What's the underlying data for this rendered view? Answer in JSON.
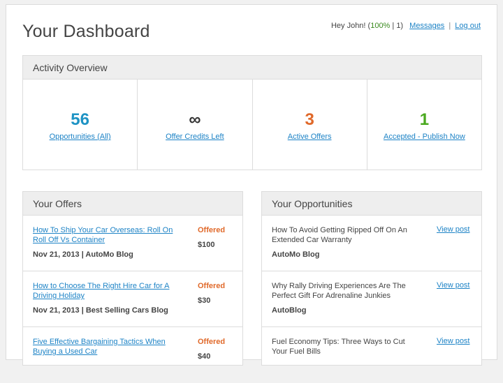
{
  "page": {
    "title": "Your Dashboard"
  },
  "userbar": {
    "greeting": "Hey John! (",
    "percent": "100%",
    "after_percent": " | 1)",
    "messages_label": "Messages",
    "separator": "|",
    "logout_label": "Log out"
  },
  "activity": {
    "header": "Activity Overview",
    "stats": [
      {
        "value": "56",
        "label": "Opportunities (All)",
        "color": "#1e93c4"
      },
      {
        "value": "∞",
        "label": "Offer Credits Left",
        "color": "#333333"
      },
      {
        "value": "3",
        "label": "Active Offers",
        "color": "#e0692a"
      },
      {
        "value": "1",
        "label": "Accepted - Publish Now",
        "color": "#4aa91f"
      }
    ]
  },
  "offers": {
    "header": "Your Offers",
    "items": [
      {
        "title": "How To Ship Your Car Overseas: Roll On Roll Off Vs Container",
        "meta": "Nov 21, 2013 | AutoMo Blog",
        "status": "Offered",
        "price": "$100"
      },
      {
        "title": "How to Choose The Right Hire Car for A Driving Holiday",
        "meta": "Nov 21, 2013 | Best Selling Cars Blog",
        "status": "Offered",
        "price": "$30"
      },
      {
        "title": "Five Effective Bargaining Tactics When Buying a Used Car",
        "meta": "",
        "status": "Offered",
        "price": "$40"
      }
    ]
  },
  "opportunities": {
    "header": "Your Opportunities",
    "items": [
      {
        "title": "How To Avoid Getting Ripped Off On An Extended Car Warranty",
        "source": "AutoMo Blog",
        "link": "View post"
      },
      {
        "title": "Why Rally Driving Experiences Are The Perfect Gift For Adrenaline Junkies",
        "source": "AutoBlog",
        "link": "View post"
      },
      {
        "title": "Fuel Economy Tips: Three Ways to Cut Your Fuel Bills",
        "source": "",
        "link": "View post"
      }
    ]
  }
}
